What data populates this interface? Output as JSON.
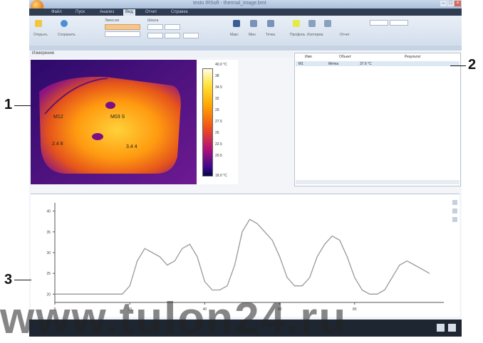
{
  "window": {
    "title": "testo IRSoft - thermal_image.bmt"
  },
  "tabs": [
    "Файл",
    "Пуск",
    "Анализ",
    "Вид",
    "Отчет",
    "Справка"
  ],
  "active_tab": 3,
  "ribbon": {
    "labels": [
      "Открыть",
      "Сохранить",
      "Эмиссия",
      "Шкала",
      "Макс",
      "Мин",
      "Точка",
      "Профиль",
      "Изотерма",
      "Отчет"
    ]
  },
  "thermal": {
    "toolbar_label": "Измерение"
  },
  "scale": {
    "ticks": [
      "40.0 °C",
      "38",
      "34.5",
      "32",
      "29",
      "27.5",
      "25",
      "22.5",
      "20.5",
      "18.0 °C"
    ]
  },
  "table": {
    "headers": [
      "Имя",
      "Объект",
      "Результат"
    ],
    "row": [
      "M1",
      "Метка",
      "37.6 °C"
    ]
  },
  "graph": {
    "y_ticks": [
      "40",
      "35",
      "30",
      "25",
      "20"
    ],
    "x_ticks": [
      "0",
      "20",
      "40",
      "60",
      "80"
    ]
  },
  "callouts": {
    "one": "1",
    "two": "2",
    "three": "3"
  },
  "watermark": "www.tulon24.ru",
  "chart_data": {
    "type": "line",
    "ylim": [
      18,
      42
    ],
    "x": [
      0,
      2,
      4,
      6,
      8,
      10,
      12,
      14,
      16,
      18,
      20,
      22,
      24,
      26,
      28,
      30,
      32,
      34,
      36,
      38,
      40,
      42,
      44,
      46,
      48,
      50,
      52,
      54,
      56,
      58,
      60,
      62,
      64,
      66,
      68,
      70,
      72,
      74,
      76,
      78,
      80,
      82,
      84,
      86,
      88,
      90,
      92,
      94,
      96,
      98,
      100
    ],
    "values": [
      20,
      20,
      20,
      20,
      20,
      20,
      20,
      20,
      20,
      20,
      22,
      28,
      31,
      30,
      29,
      27,
      28,
      31,
      32,
      29,
      23,
      21,
      21,
      22,
      27,
      35,
      38,
      37,
      35,
      33,
      29,
      24,
      22,
      22,
      24,
      29,
      32,
      34,
      33,
      29,
      24,
      21,
      20,
      20,
      21,
      24,
      27,
      28,
      27,
      26,
      25
    ]
  }
}
